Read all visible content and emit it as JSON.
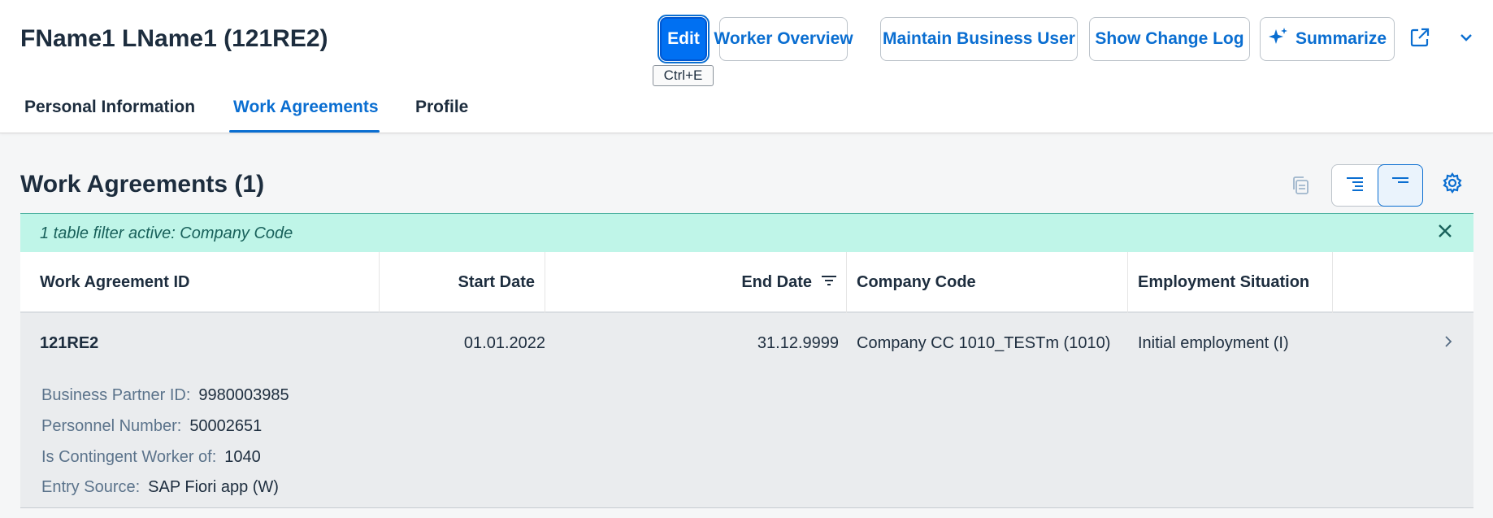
{
  "header": {
    "title": "FName1 LName1 (121RE2)",
    "actions": {
      "edit": "Edit",
      "worker_overview": "Worker Overview",
      "maintain_business_user": "Maintain Business User",
      "show_change_log": "Show Change Log",
      "summarize": "Summarize"
    },
    "tooltip": "Ctrl+E"
  },
  "tabs": [
    {
      "label": "Personal Information"
    },
    {
      "label": "Work Agreements"
    },
    {
      "label": "Profile"
    }
  ],
  "section": {
    "title": "Work Agreements (1)"
  },
  "filter": {
    "text": "1 table filter active: Company Code"
  },
  "table": {
    "columns": [
      "Work Agreement ID",
      "Start Date",
      "End Date",
      "Company Code",
      "Employment Situation"
    ],
    "rows": [
      {
        "id": "121RE2",
        "start_date": "01.01.2022",
        "end_date": "31.12.9999",
        "company_code": "Company CC 1010_TESTm (1010)",
        "employment_situation": "Initial employment (I)",
        "details": [
          {
            "label": "Business Partner ID:",
            "value": "9980003985"
          },
          {
            "label": "Personnel Number:",
            "value": "50002651"
          },
          {
            "label": "Is Contingent Worker of:",
            "value": "1040"
          },
          {
            "label": "Entry Source:",
            "value": "SAP Fiori app (W)"
          }
        ]
      }
    ]
  },
  "colors": {
    "accent": "#0a6ed1",
    "primary_button": "#0070f2",
    "filter_banner": "#bff5e8",
    "row_background": "#eaecee"
  }
}
